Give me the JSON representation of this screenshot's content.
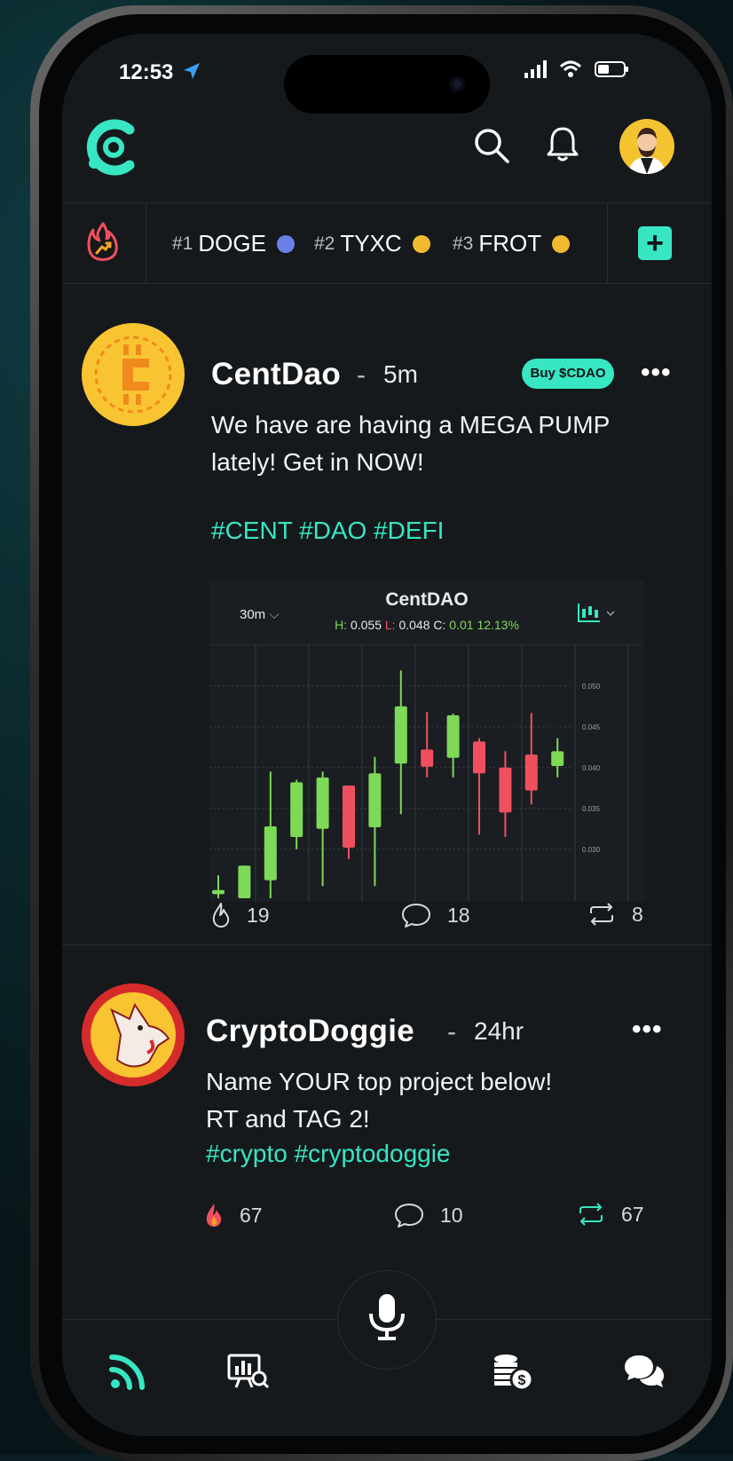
{
  "status_bar": {
    "time": "12:53"
  },
  "trending": {
    "tickers": [
      {
        "rank": "#1",
        "symbol": "DOGE",
        "coin_color": "#6b7fe8"
      },
      {
        "rank": "#2",
        "symbol": "TYXC",
        "coin_color": "#f3ba2f"
      },
      {
        "rank": "#3",
        "symbol": "FROT",
        "coin_color": "#f3ba2f"
      }
    ],
    "add_label": "+"
  },
  "posts": [
    {
      "username": "CentDao",
      "separator": "-",
      "time_ago": "5m",
      "buy_label": "Buy $CDAO",
      "more": "•••",
      "body_lines": [
        "We have are having a MEGA PUMP",
        "lately! Get in NOW!"
      ],
      "tags": "#CENT #DAO #DEFI",
      "likes": "19",
      "comments": "18",
      "reposts": "8"
    },
    {
      "username": "CryptoDoggie",
      "separator": "-",
      "time_ago": "24hr",
      "more": "•••",
      "body_lines": [
        "Name YOUR top project below!",
        "RT and TAG 2!"
      ],
      "tags": "#crypto #cryptodoggie",
      "likes": "67",
      "comments": "10",
      "reposts": "67"
    }
  ],
  "chart_header": {
    "interval": "30m",
    "h_label": "H:",
    "h_value": "0.055",
    "l_label": "L:",
    "l_value": "0.048",
    "c_label": "C:",
    "c_value": "0.01",
    "change": "12.13%"
  },
  "chart_data": {
    "type": "candlestick",
    "title": "CentDAO",
    "y_ticks": [
      "0.050",
      "0.045",
      "0.040",
      "0.035",
      "0.030"
    ],
    "ylim": [
      0.024,
      0.054
    ],
    "up_color": "#7ed957",
    "down_color": "#f0505e",
    "candles": [
      {
        "o": 0.0245,
        "h": 0.0268,
        "l": 0.024,
        "c": 0.025
      },
      {
        "o": 0.024,
        "h": 0.0268,
        "l": 0.024,
        "c": 0.028
      },
      {
        "o": 0.0262,
        "h": 0.0395,
        "l": 0.024,
        "c": 0.0328
      },
      {
        "o": 0.0315,
        "h": 0.0385,
        "l": 0.03,
        "c": 0.0382
      },
      {
        "o": 0.0325,
        "h": 0.0395,
        "l": 0.0255,
        "c": 0.0388
      },
      {
        "o": 0.0378,
        "h": 0.0368,
        "l": 0.0288,
        "c": 0.0302
      },
      {
        "o": 0.0327,
        "h": 0.0413,
        "l": 0.0255,
        "c": 0.0393
      },
      {
        "o": 0.0405,
        "h": 0.0519,
        "l": 0.0343,
        "c": 0.0475
      },
      {
        "o": 0.0422,
        "h": 0.0468,
        "l": 0.0388,
        "c": 0.0401
      },
      {
        "o": 0.0412,
        "h": 0.0466,
        "l": 0.0388,
        "c": 0.0464
      },
      {
        "o": 0.0432,
        "h": 0.0436,
        "l": 0.0318,
        "c": 0.0393
      },
      {
        "o": 0.04,
        "h": 0.042,
        "l": 0.0315,
        "c": 0.0345
      },
      {
        "o": 0.0416,
        "h": 0.0467,
        "l": 0.0355,
        "c": 0.0372
      },
      {
        "o": 0.0402,
        "h": 0.0436,
        "l": 0.0388,
        "c": 0.042
      }
    ]
  },
  "nav": {
    "items": [
      {
        "name": "feed-icon",
        "active": true
      },
      {
        "name": "market-analytics-icon",
        "active": false
      },
      {
        "name": "microphone-icon",
        "active": false
      },
      {
        "name": "coins-dollar-icon",
        "active": false
      },
      {
        "name": "chat-bubbles-icon",
        "active": false
      }
    ]
  },
  "colors": {
    "accent": "#37e6c2",
    "background": "#15191c",
    "divider": "#262c30"
  }
}
